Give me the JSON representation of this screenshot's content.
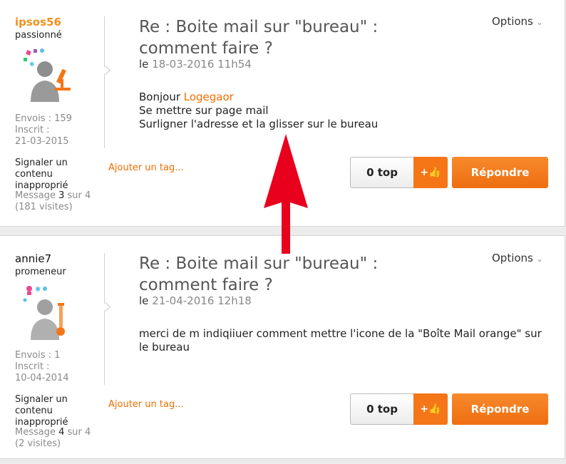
{
  "posts": [
    {
      "username": "ipsos56",
      "rank": "passionné",
      "stats": [
        "Envois : 159",
        "Inscrit :",
        "21-03-2015"
      ],
      "report_link": "Signaler un contenu inapproprié",
      "message_prefix": "Message ",
      "message_num": "3",
      "message_suffix": " sur 4",
      "visits": "(181 visites)",
      "title": "Re : Boite mail sur \"bureau\" : comment faire ?",
      "date_prefix": "le",
      "date": "18-03-2016 11h54",
      "options_label": "Options",
      "body_greeting": "Bonjour ",
      "body_mention": "Logegaor",
      "body_lines": [
        "Se mettre sur page mail",
        "Surligner l'adresse et la glisser sur le bureau"
      ],
      "add_tag": "Ajouter un tag...",
      "top_count": "0 top",
      "top_button": "+👍",
      "reply_button": "Répondre"
    },
    {
      "username": "annie7",
      "rank": "promeneur",
      "stats": [
        "Envois : 1",
        "Inscrit :",
        "10-04-2014"
      ],
      "report_link": "Signaler un contenu inapproprié",
      "message_prefix": "Message ",
      "message_num": "4",
      "message_suffix": " sur 4",
      "visits": "(2 visites)",
      "title": "Re : Boite mail sur \"bureau\" : comment faire ?",
      "date_prefix": "le",
      "date": "21-04-2016 12h18",
      "options_label": "Options",
      "body_text": "merci de m indiqiiuer comment mettre l'icone de la \"Boîte Mail orange\" sur le bureau",
      "add_tag": "Ajouter un tag...",
      "top_count": "0 top",
      "top_button": "+👍",
      "reply_button": "Répondre"
    }
  ],
  "colors": {
    "accent": "#f16e00",
    "username_highlight": "#f0901e",
    "arrow": "#e8001c"
  }
}
